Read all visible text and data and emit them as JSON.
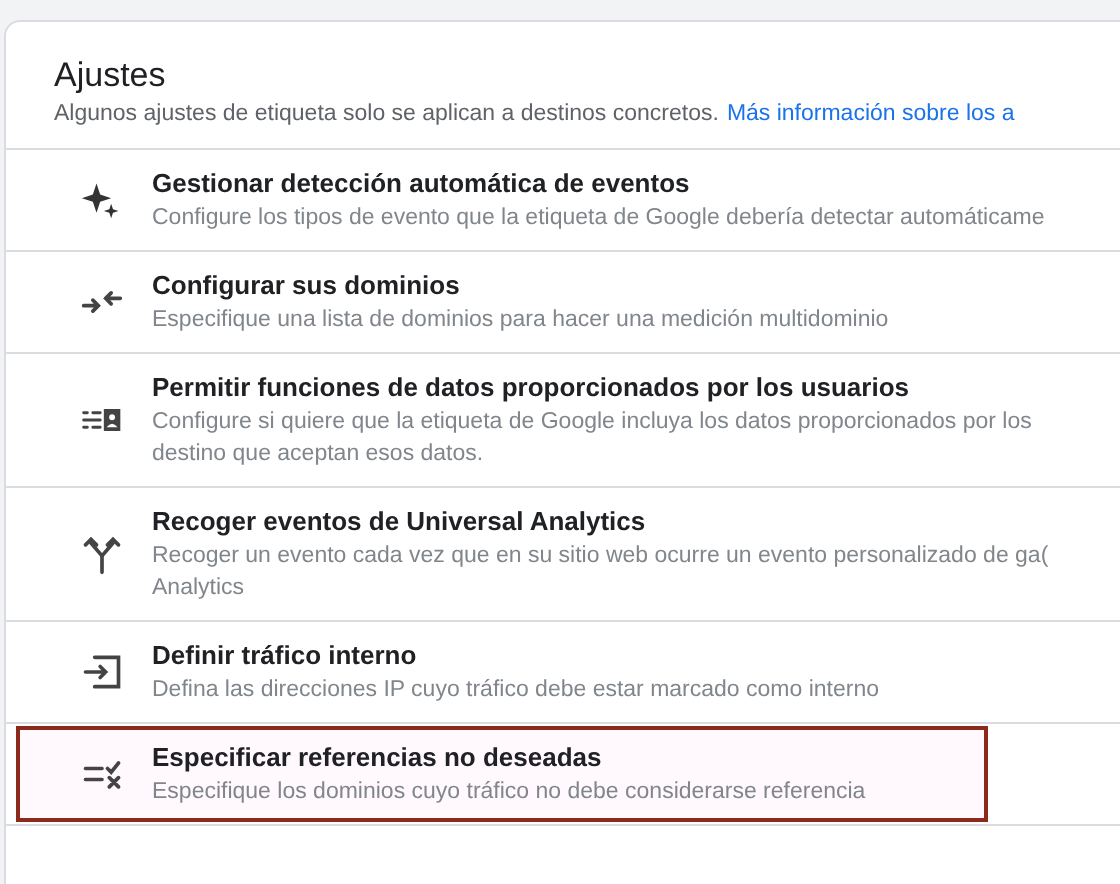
{
  "header": {
    "title": "Ajustes",
    "subtitle": "Algunos ajustes de etiqueta solo se aplican a destinos concretos.",
    "link": "Más información sobre los a"
  },
  "items": [
    {
      "kind": "sparkle",
      "title": "Gestionar detección automática de eventos",
      "description": [
        "Configure los tipos de evento que la etiqueta de Google debería detectar automáticame"
      ],
      "highlighted": false
    },
    {
      "kind": "merge",
      "title": "Configurar sus dominios",
      "description": [
        "Especifique una lista de dominios para hacer una medición multidominio"
      ],
      "highlighted": false
    },
    {
      "kind": "userdata",
      "title": "Permitir funciones de datos proporcionados por los usuarios",
      "description": [
        "Configure si quiere que la etiqueta de Google incluya los datos proporcionados por los",
        "destino que aceptan esos datos."
      ],
      "highlighted": false
    },
    {
      "kind": "fork",
      "title": "Recoger eventos de Universal Analytics",
      "description": [
        "Recoger un evento cada vez que en su sitio web ocurre un evento personalizado de ga(",
        "Analytics"
      ],
      "highlighted": false
    },
    {
      "kind": "login",
      "title": "Definir tráfico interno",
      "description": [
        "Defina las direcciones IP cuyo tráfico debe estar marcado como interno"
      ],
      "highlighted": false
    },
    {
      "kind": "checkx",
      "title": "Especificar referencias no deseadas",
      "description": [
        "Especifique los dominios cuyo tráfico no debe considerarse referencia"
      ],
      "highlighted": true
    }
  ]
}
